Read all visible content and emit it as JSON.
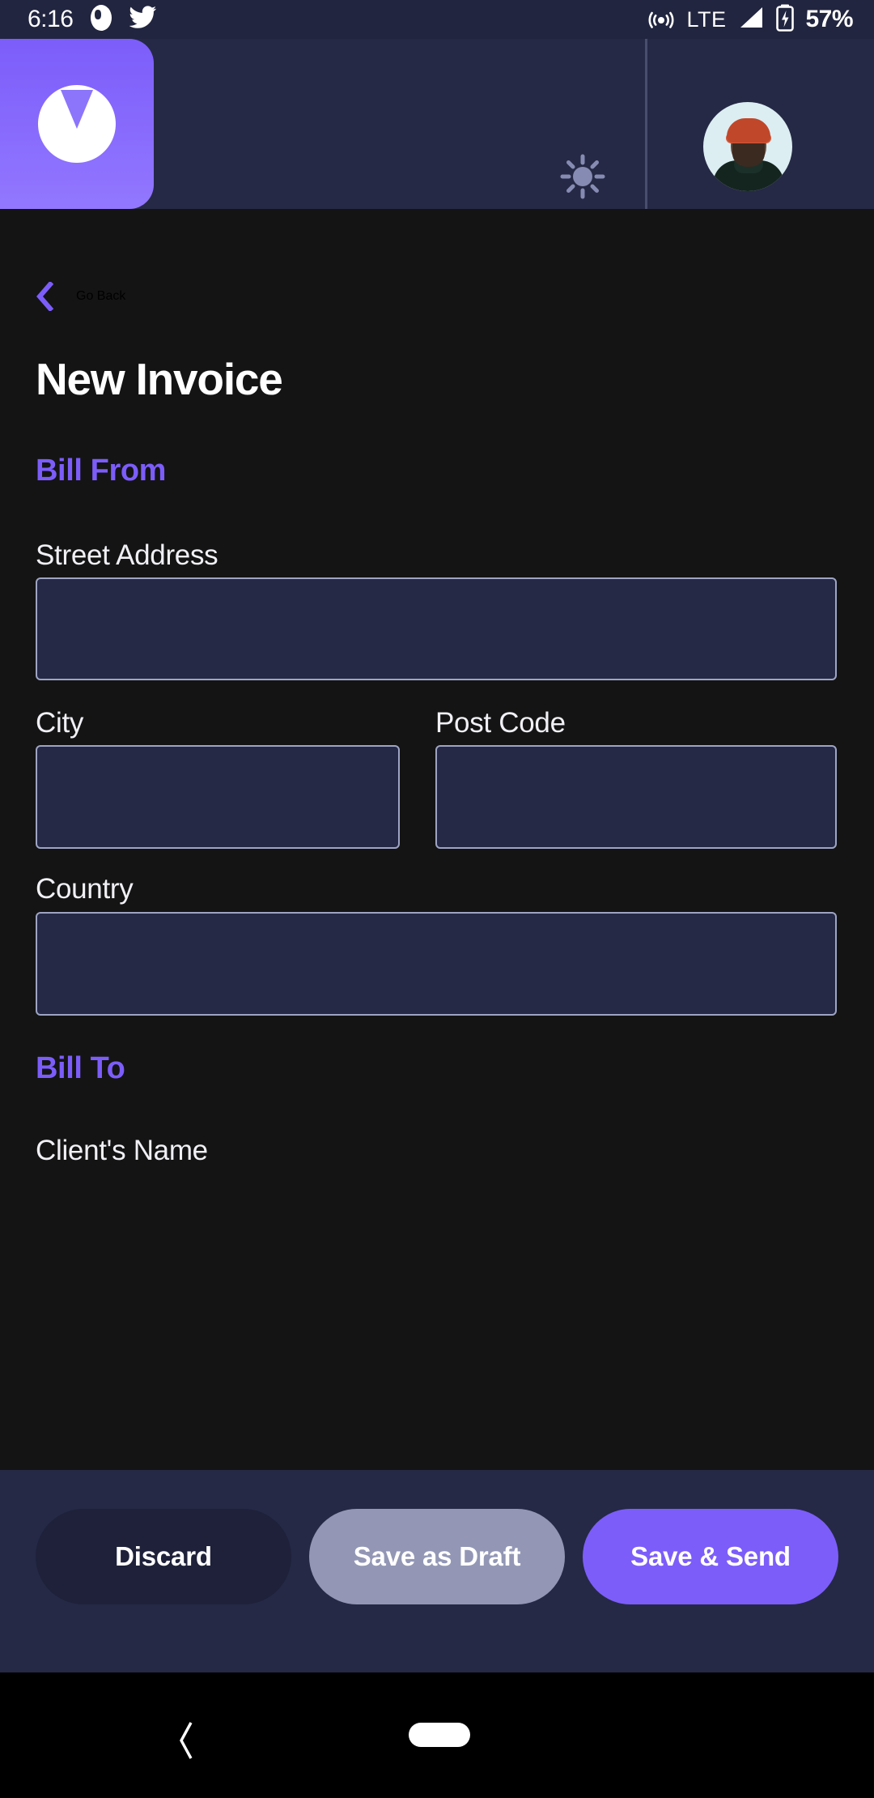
{
  "status_bar": {
    "clock": "6:16",
    "left_icons": [
      "ghost-app-icon",
      "twitter-icon"
    ],
    "network_label": "LTE",
    "right_icons": [
      "hotspot-icon",
      "signal-icon",
      "battery-charging-icon"
    ],
    "battery_percent": "57%"
  },
  "header": {
    "logo_name": "invoice-app-logo",
    "theme_toggle_icon": "sun-icon",
    "avatar_name": "user-avatar",
    "colors": {
      "header_bg": "#252945",
      "logo_purple": "#7C5DFA",
      "divider": "#494E6E",
      "sun_icon": "#858BB2"
    }
  },
  "page": {
    "back_label": "Go Back",
    "back_icon": "chevron-left-icon",
    "title": "New Invoice",
    "background": "#141414"
  },
  "form": {
    "sections": [
      {
        "heading": "Bill From"
      },
      {
        "heading": "Bill To"
      }
    ],
    "bill_from": {
      "street": {
        "label": "Street Address",
        "value": "",
        "placeholder": ""
      },
      "city": {
        "label": "City",
        "value": "",
        "placeholder": ""
      },
      "post_code": {
        "label": "Post Code",
        "value": "",
        "placeholder": ""
      },
      "country": {
        "label": "Country",
        "value": "",
        "placeholder": ""
      }
    },
    "bill_to": {
      "client_name": {
        "label": "Client's Name",
        "value": "",
        "placeholder": ""
      }
    },
    "field_colors": {
      "fill": "#252945",
      "border": "#9EA4C4",
      "label": "#F0F0F5",
      "section_heading": "#7C5DFA"
    }
  },
  "actions": {
    "discard": "Discard",
    "save_draft": "Save as Draft",
    "save_send": "Save & Send",
    "colors": {
      "bar_bg": "#252945",
      "discard_bg": "#1E2139",
      "save_draft_bg": "#9397B5",
      "save_send_bg": "#7C5DFA"
    }
  },
  "nav_bar": {
    "back_icon": "nav-back-chevron-icon",
    "home_icon": "nav-home-pill-icon"
  }
}
